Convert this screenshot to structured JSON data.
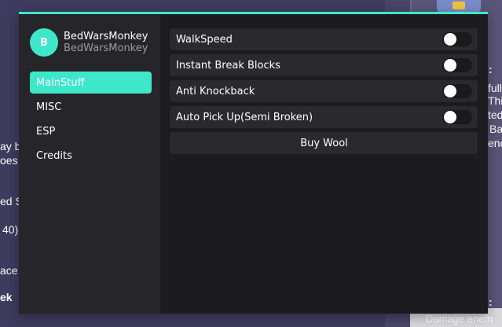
{
  "window": {
    "accent_color": "#3ee7c9",
    "profile": {
      "avatar_letter": "B",
      "display_name": "BedWarsMonkey",
      "username": "BedWarsMonkey"
    },
    "sidebar": {
      "items": [
        {
          "label": "MainStuff",
          "active": true
        },
        {
          "label": "MISC",
          "active": false
        },
        {
          "label": "ESP",
          "active": false
        },
        {
          "label": "Credits",
          "active": false
        }
      ]
    },
    "main": {
      "toggles": [
        {
          "label": "WalkSpeed",
          "on": false
        },
        {
          "label": "Instant Break Blocks",
          "on": false
        },
        {
          "label": "Anti Knockback",
          "on": false
        },
        {
          "label": "Auto Pick Up(Semi Broken)",
          "on": false
        }
      ],
      "button": {
        "label": "Buy Wool"
      }
    }
  },
  "background": {
    "left_fragments": [
      "ay b",
      "oes",
      "ed S",
      "40)",
      "ace",
      "ek"
    ],
    "right_fragments": [
      ":",
      "full",
      "This",
      "ted",
      "Ba",
      "enc",
      ":",
      "Damage enem"
    ]
  }
}
